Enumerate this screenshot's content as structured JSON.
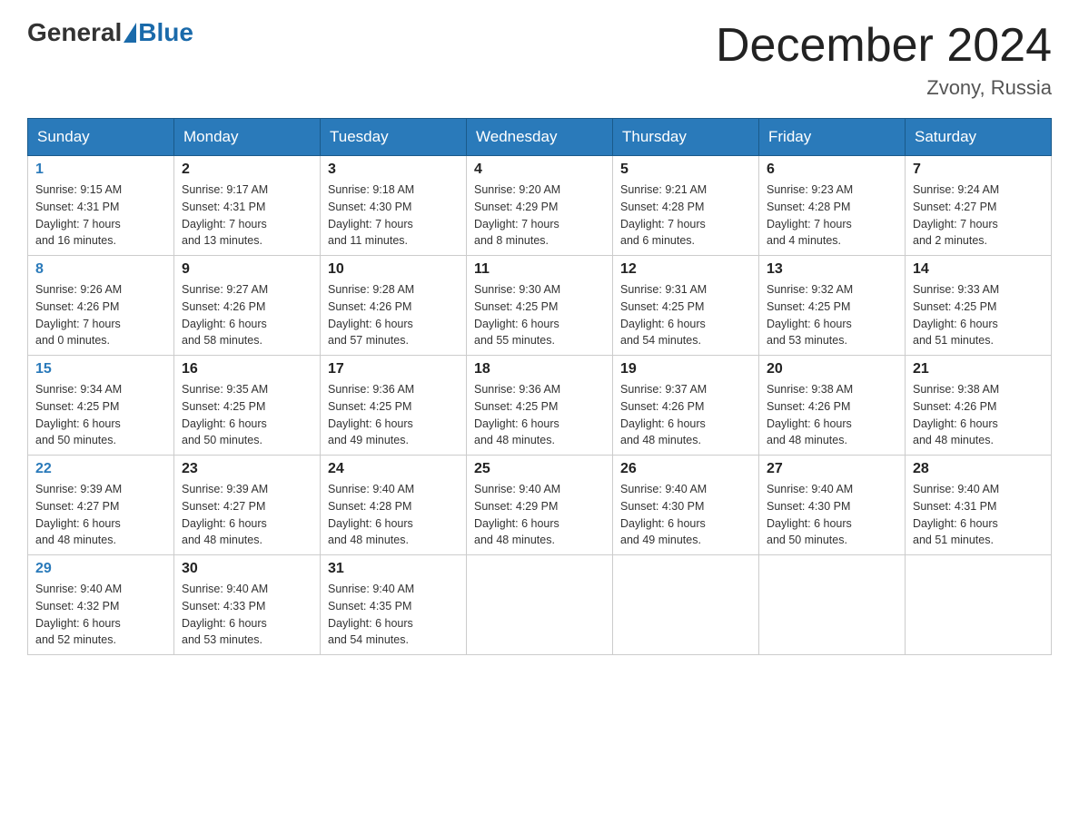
{
  "logo": {
    "general": "General",
    "blue": "Blue"
  },
  "title": "December 2024",
  "location": "Zvony, Russia",
  "days_of_week": [
    "Sunday",
    "Monday",
    "Tuesday",
    "Wednesday",
    "Thursday",
    "Friday",
    "Saturday"
  ],
  "weeks": [
    [
      {
        "day": "1",
        "sunrise": "9:15 AM",
        "sunset": "4:31 PM",
        "daylight": "7 hours and 16 minutes."
      },
      {
        "day": "2",
        "sunrise": "9:17 AM",
        "sunset": "4:31 PM",
        "daylight": "7 hours and 13 minutes."
      },
      {
        "day": "3",
        "sunrise": "9:18 AM",
        "sunset": "4:30 PM",
        "daylight": "7 hours and 11 minutes."
      },
      {
        "day": "4",
        "sunrise": "9:20 AM",
        "sunset": "4:29 PM",
        "daylight": "7 hours and 8 minutes."
      },
      {
        "day": "5",
        "sunrise": "9:21 AM",
        "sunset": "4:28 PM",
        "daylight": "7 hours and 6 minutes."
      },
      {
        "day": "6",
        "sunrise": "9:23 AM",
        "sunset": "4:28 PM",
        "daylight": "7 hours and 4 minutes."
      },
      {
        "day": "7",
        "sunrise": "9:24 AM",
        "sunset": "4:27 PM",
        "daylight": "7 hours and 2 minutes."
      }
    ],
    [
      {
        "day": "8",
        "sunrise": "9:26 AM",
        "sunset": "4:26 PM",
        "daylight": "7 hours and 0 minutes."
      },
      {
        "day": "9",
        "sunrise": "9:27 AM",
        "sunset": "4:26 PM",
        "daylight": "6 hours and 58 minutes."
      },
      {
        "day": "10",
        "sunrise": "9:28 AM",
        "sunset": "4:26 PM",
        "daylight": "6 hours and 57 minutes."
      },
      {
        "day": "11",
        "sunrise": "9:30 AM",
        "sunset": "4:25 PM",
        "daylight": "6 hours and 55 minutes."
      },
      {
        "day": "12",
        "sunrise": "9:31 AM",
        "sunset": "4:25 PM",
        "daylight": "6 hours and 54 minutes."
      },
      {
        "day": "13",
        "sunrise": "9:32 AM",
        "sunset": "4:25 PM",
        "daylight": "6 hours and 53 minutes."
      },
      {
        "day": "14",
        "sunrise": "9:33 AM",
        "sunset": "4:25 PM",
        "daylight": "6 hours and 51 minutes."
      }
    ],
    [
      {
        "day": "15",
        "sunrise": "9:34 AM",
        "sunset": "4:25 PM",
        "daylight": "6 hours and 50 minutes."
      },
      {
        "day": "16",
        "sunrise": "9:35 AM",
        "sunset": "4:25 PM",
        "daylight": "6 hours and 50 minutes."
      },
      {
        "day": "17",
        "sunrise": "9:36 AM",
        "sunset": "4:25 PM",
        "daylight": "6 hours and 49 minutes."
      },
      {
        "day": "18",
        "sunrise": "9:36 AM",
        "sunset": "4:25 PM",
        "daylight": "6 hours and 48 minutes."
      },
      {
        "day": "19",
        "sunrise": "9:37 AM",
        "sunset": "4:26 PM",
        "daylight": "6 hours and 48 minutes."
      },
      {
        "day": "20",
        "sunrise": "9:38 AM",
        "sunset": "4:26 PM",
        "daylight": "6 hours and 48 minutes."
      },
      {
        "day": "21",
        "sunrise": "9:38 AM",
        "sunset": "4:26 PM",
        "daylight": "6 hours and 48 minutes."
      }
    ],
    [
      {
        "day": "22",
        "sunrise": "9:39 AM",
        "sunset": "4:27 PM",
        "daylight": "6 hours and 48 minutes."
      },
      {
        "day": "23",
        "sunrise": "9:39 AM",
        "sunset": "4:27 PM",
        "daylight": "6 hours and 48 minutes."
      },
      {
        "day": "24",
        "sunrise": "9:40 AM",
        "sunset": "4:28 PM",
        "daylight": "6 hours and 48 minutes."
      },
      {
        "day": "25",
        "sunrise": "9:40 AM",
        "sunset": "4:29 PM",
        "daylight": "6 hours and 48 minutes."
      },
      {
        "day": "26",
        "sunrise": "9:40 AM",
        "sunset": "4:30 PM",
        "daylight": "6 hours and 49 minutes."
      },
      {
        "day": "27",
        "sunrise": "9:40 AM",
        "sunset": "4:30 PM",
        "daylight": "6 hours and 50 minutes."
      },
      {
        "day": "28",
        "sunrise": "9:40 AM",
        "sunset": "4:31 PM",
        "daylight": "6 hours and 51 minutes."
      }
    ],
    [
      {
        "day": "29",
        "sunrise": "9:40 AM",
        "sunset": "4:32 PM",
        "daylight": "6 hours and 52 minutes."
      },
      {
        "day": "30",
        "sunrise": "9:40 AM",
        "sunset": "4:33 PM",
        "daylight": "6 hours and 53 minutes."
      },
      {
        "day": "31",
        "sunrise": "9:40 AM",
        "sunset": "4:35 PM",
        "daylight": "6 hours and 54 minutes."
      },
      null,
      null,
      null,
      null
    ]
  ],
  "labels": {
    "sunrise": "Sunrise:",
    "sunset": "Sunset:",
    "daylight": "Daylight:"
  }
}
